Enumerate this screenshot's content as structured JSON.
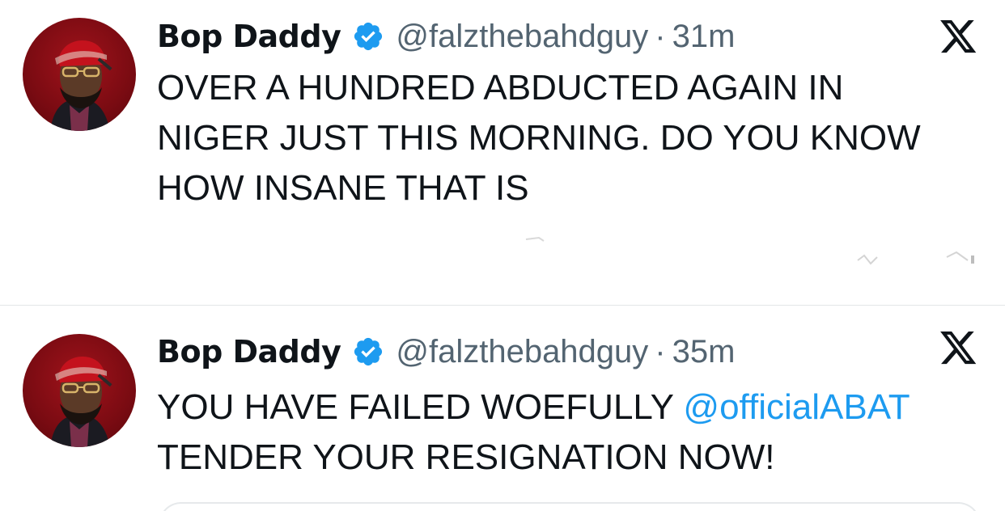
{
  "colors": {
    "name": "#0f1419",
    "secondary": "#536471",
    "verified": "#1d9bf0",
    "mention": "#1d9bf0",
    "avatar_bg": "#7a0b12",
    "divider": "#e3e6e8"
  },
  "icons": {
    "verified": "verified-badge-icon",
    "close": "x-logo-icon"
  },
  "tweets": [
    {
      "display_name": "Bop Daddy",
      "handle": "@falzthebahdguy",
      "separator": "·",
      "time": "31m",
      "lines": [
        "OVER A HUNDRED ABDUCTED AGAIN IN",
        "NIGER JUST THIS MORNING. DO YOU KNOW",
        "HOW INSANE THAT IS"
      ]
    },
    {
      "display_name": "Bop Daddy",
      "handle": "@falzthebahdguy",
      "separator": "·",
      "time": "35m",
      "line1_text": "YOU HAVE FAILED WOEFULLY ",
      "mention": "@officialABAT",
      "line2_text": "TENDER YOUR RESIGNATION NOW!"
    }
  ]
}
